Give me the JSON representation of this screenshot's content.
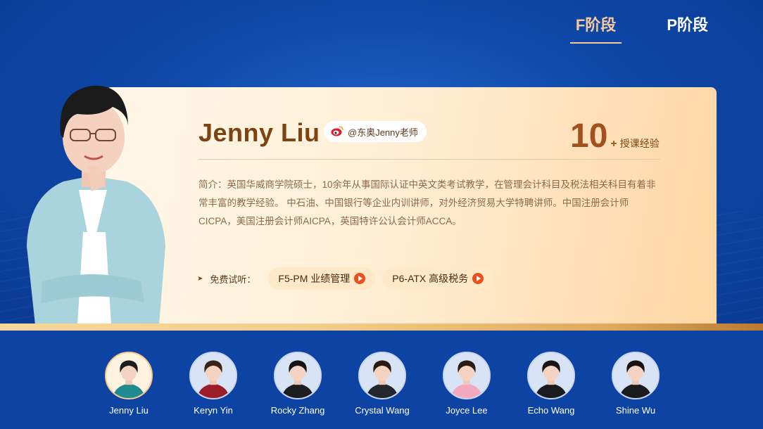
{
  "tabs": [
    {
      "label": "F阶段",
      "active": true
    },
    {
      "label": "P阶段",
      "active": false
    }
  ],
  "teacher_profile": {
    "name": "Jenny Liu",
    "weibo": "@东奥Jenny老师",
    "experience_number": "10",
    "experience_plus": "+",
    "experience_label": "授课经验",
    "intro": "简介：英国华威商学院硕士，10余年从事国际认证中英文类考试教学，在管理会计科目及税法相关科目有着非常丰富的教学经验。 中石油、中国银行等企业内训讲师，对外经济贸易大学特聘讲师。中国注册会计师CICPA，美国注册会计师AICPA，英国特许公认会计师ACCA。",
    "trial_label": "免费试听：",
    "courses": [
      {
        "label": "F5-PM 业绩管理"
      },
      {
        "label": "P6-ATX 高级税务"
      }
    ]
  },
  "teachers": [
    {
      "name": "Jenny Liu",
      "active": true,
      "top": "#1f8a8f",
      "hair": "#1c1c1c"
    },
    {
      "name": "Keryn Yin",
      "active": false,
      "top": "#9b1d2a",
      "hair": "#3a2418"
    },
    {
      "name": "Rocky Zhang",
      "active": false,
      "top": "#1d1d22",
      "hair": "#141414"
    },
    {
      "name": "Crystal Wang",
      "active": false,
      "top": "#22262d",
      "hair": "#2a1a12"
    },
    {
      "name": "Joyce Lee",
      "active": false,
      "top": "#f2a9c0",
      "hair": "#2b1c14"
    },
    {
      "name": "Echo Wang",
      "active": false,
      "top": "#1b1b1f",
      "hair": "#161616"
    },
    {
      "name": "Shine Wu",
      "active": false,
      "top": "#1b1b1f",
      "hair": "#1a1410"
    }
  ],
  "colors": {
    "accent_tab": "#f6c99a",
    "name_brown": "#7b4412",
    "play_red": "#ea4f1c",
    "bg_blue": "#0d43a3"
  }
}
